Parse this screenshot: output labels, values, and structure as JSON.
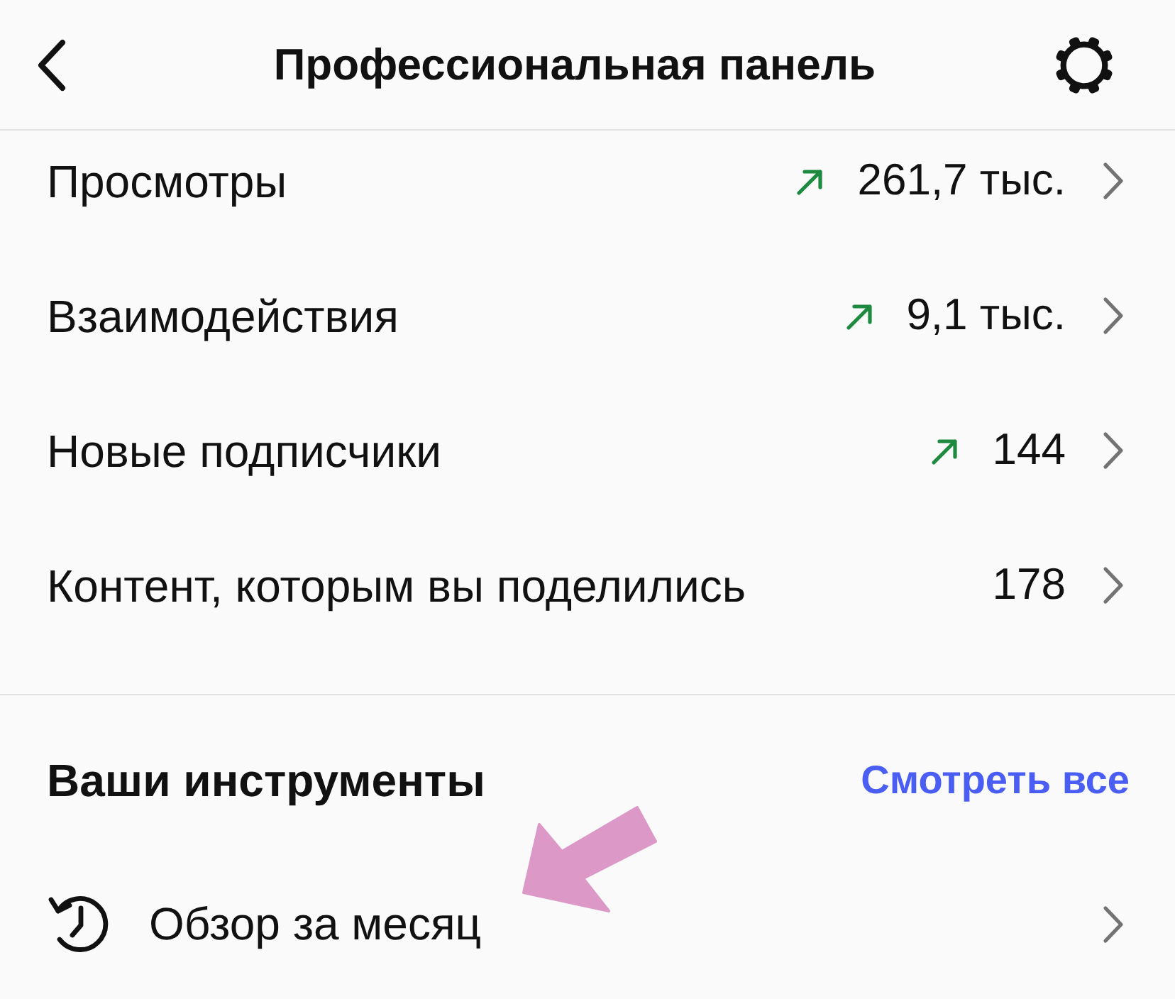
{
  "header": {
    "title": "Профессиональная панель"
  },
  "metrics": [
    {
      "label": "Просмотры",
      "trend_up": true,
      "value": "261,7 тыс."
    },
    {
      "label": "Взаимодействия",
      "trend_up": true,
      "value": "9,1 тыс."
    },
    {
      "label": "Новые подписчики",
      "trend_up": true,
      "value": "144"
    },
    {
      "label": "Контент, которым вы поделились",
      "trend_up": false,
      "value": "178"
    }
  ],
  "tools": {
    "title": "Ваши инструменты",
    "link": "Смотреть все",
    "items": [
      {
        "label": "Обзор за месяц"
      }
    ]
  }
}
